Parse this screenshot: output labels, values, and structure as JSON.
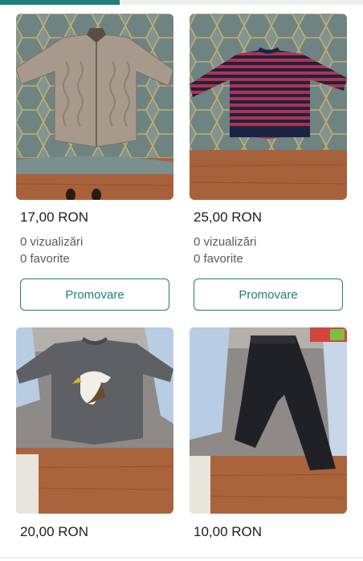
{
  "progress": 0.33,
  "colors": {
    "accent": "#1f7f7a",
    "text": "#1c1c1c",
    "muted": "#5b5b5b"
  },
  "listings": [
    {
      "price": "17,00 RON",
      "views": "0 vizualizări",
      "favorites": "0 favorite",
      "promote_label": "Promovare",
      "image": "beige-cable-knit-cardigan-photo"
    },
    {
      "price": "25,00 RON",
      "views": "0 vizualizări",
      "favorites": "0 favorite",
      "promote_label": "Promovare",
      "image": "striped-red-navy-sweater-photo"
    },
    {
      "price": "20,00 RON",
      "image": "grey-eagle-sweatshirt-photo"
    },
    {
      "price": "10,00 RON",
      "image": "black-trousers-photo"
    }
  ]
}
